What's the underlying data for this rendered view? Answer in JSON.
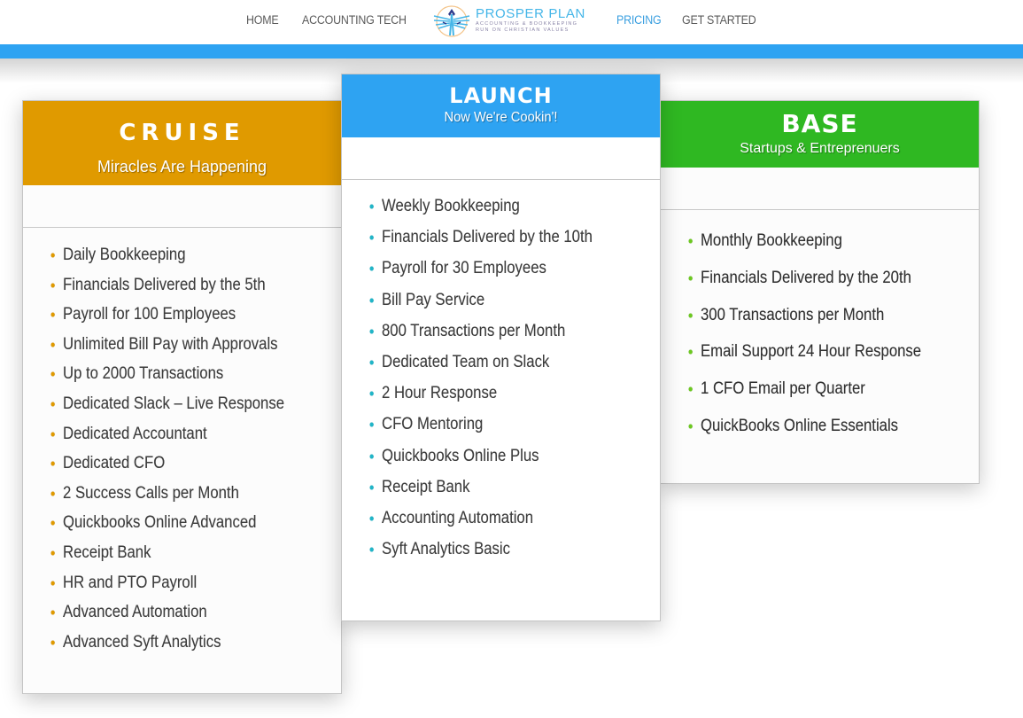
{
  "nav": {
    "items": [
      {
        "label": "HOME",
        "active": false
      },
      {
        "label": "ACCOUNTING TECH",
        "active": false
      },
      {
        "label": "PRICING",
        "active": true
      },
      {
        "label": "GET STARTED",
        "active": false
      }
    ],
    "logo": {
      "icon": "eagle-logo-icon",
      "title": "PROSPER PLAN",
      "tagline1": "ACCOUNTING & BOOKKEEPING",
      "tagline2": "RUN ON CHRISTIAN VALUES"
    }
  },
  "colors": {
    "band": "#2ea3f2",
    "cruise": "#e09a00",
    "launch": "#2ea3f2",
    "base": "#2fb822",
    "launch_bullet": "#20b5c8",
    "base_bullet": "#6cc820"
  },
  "plans": {
    "cruise": {
      "title": "CRUISE",
      "subtitle": "Miracles Are Happening",
      "features": [
        "Daily Bookkeeping",
        "Financials Delivered by the 5th",
        "Payroll for 100 Employees",
        "Unlimited Bill Pay with Approvals",
        "Up to 2000 Transactions",
        "Dedicated Slack – Live Response",
        "Dedicated Accountant",
        "Dedicated CFO",
        "2 Success Calls per Month",
        "Quickbooks Online Advanced",
        "Receipt Bank",
        "HR and PTO Payroll",
        "Advanced Automation",
        "Advanced Syft Analytics"
      ]
    },
    "launch": {
      "title": "LAUNCH",
      "subtitle": "Now We're Cookin'!",
      "features": [
        "Weekly Bookkeeping",
        "Financials Delivered by the 10th",
        "Payroll for 30 Employees",
        "Bill Pay Service",
        "800 Transactions per Month",
        "Dedicated Team on Slack",
        "2 Hour Response",
        "CFO Mentoring",
        "Quickbooks Online Plus",
        "Receipt Bank",
        "Accounting Automation",
        "Syft Analytics Basic"
      ]
    },
    "base": {
      "title": "BASE",
      "subtitle": "Startups & Entreprenuers",
      "features": [
        "Monthly Bookkeeping",
        "Financials Delivered by the 20th",
        "300 Transactions per Month",
        "Email Support 24 Hour Response",
        "1 CFO Email per Quarter",
        "QuickBooks Online Essentials"
      ]
    }
  }
}
